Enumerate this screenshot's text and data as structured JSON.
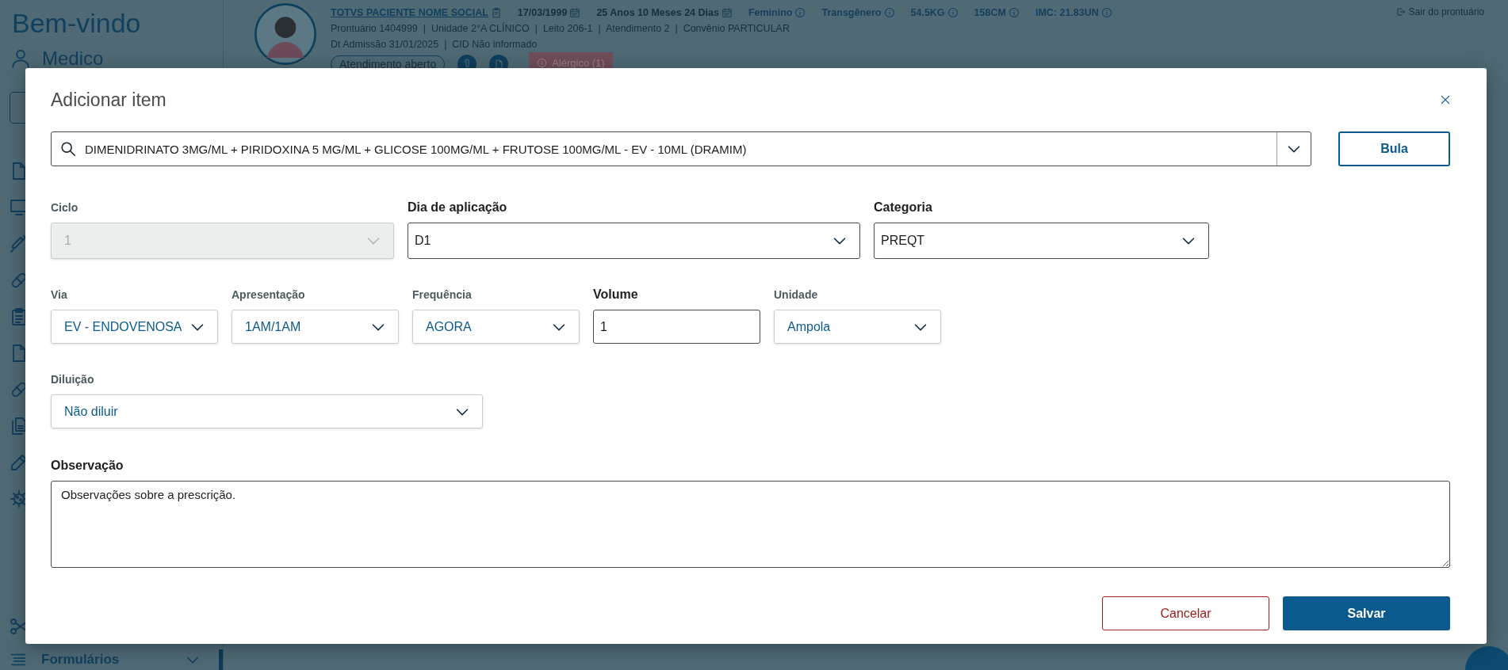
{
  "sidebar": {
    "title": "Bem-vindo",
    "user": "Medico",
    "menu": [
      {
        "label": "Formulários",
        "expanded": false
      }
    ]
  },
  "patient": {
    "name": "TOTVS PACIENTE NOME SOCIAL",
    "birth_date": "17/03/1999",
    "age": "25 Anos 10 Meses 24 Dias",
    "tags": [
      "Feminino",
      "Transgênero",
      "54.5KG",
      "158CM",
      "IMC: 21.83UN"
    ],
    "details": [
      "Prontuário 1404999  |  Unidade 2°A CLÍNICO  |  Leito 206-1  |  Atendimento 2  |  Convênio PARTICULAR",
      "Dt Admissão 31/01/2025  |  CID Não informado"
    ],
    "status": "Atendimento aberto",
    "alert": "Alérgico (1)",
    "exit_link": "Sair do prontuário"
  },
  "dialog": {
    "title": "Adicionar item",
    "search": {
      "value": "DIMENIDRINATO 3MG/ML + PIRIDOXINA 5 MG/ML + GLICOSE 100MG/ML + FRUTOSE 100MG/ML - EV - 10ML (DRAMIM)"
    },
    "info_button": "Bula",
    "sections": [
      {
        "fields": [
          {
            "kind": "select",
            "label": "Ciclo",
            "value": "1",
            "disabled": true,
            "emphasized": false
          },
          {
            "kind": "select",
            "label": "Dia de aplicação",
            "value": "D1",
            "disabled": false,
            "emphasized": true
          },
          {
            "kind": "select",
            "label": "Categoria",
            "value": "PREQT",
            "disabled": false,
            "emphasized": true
          }
        ]
      },
      {
        "fields": [
          {
            "kind": "select",
            "label": "Via",
            "value": "EV - ENDOVENOSA",
            "disabled": false,
            "emphasized": false
          },
          {
            "kind": "select",
            "label": "Apresentação",
            "value": "1AM/1AM",
            "disabled": false,
            "emphasized": false
          },
          {
            "kind": "select",
            "label": "Frequência",
            "value": "AGORA",
            "disabled": false,
            "emphasized": false
          },
          {
            "kind": "input",
            "label": "Volume",
            "value": "1",
            "disabled": false,
            "emphasized": true
          },
          {
            "kind": "select",
            "label": "Unidade",
            "value": "Ampola",
            "disabled": false,
            "emphasized": false
          }
        ]
      },
      {
        "fields": [
          {
            "kind": "select",
            "label": "Diluição",
            "value": "Não diluir",
            "disabled": false,
            "emphasized": false
          }
        ]
      }
    ],
    "notes": {
      "label": "Observação",
      "value": "Observações sobre a prescrição."
    },
    "buttons": [
      {
        "label": "Cancelar",
        "kind": "secondary"
      },
      {
        "label": "Salvar",
        "kind": "primary"
      }
    ]
  }
}
